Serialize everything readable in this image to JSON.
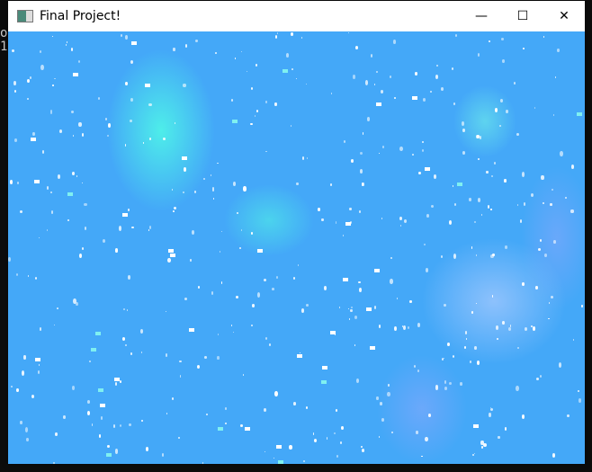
{
  "window": {
    "title": "Final Project!",
    "icon": "app-window-icon"
  },
  "controls": {
    "minimize": "—",
    "maximize": "☐",
    "close": "✕"
  },
  "console": {
    "chars": "o\n1"
  },
  "colors": {
    "background": "#44a8f8",
    "titlebar": "#ffffff"
  }
}
